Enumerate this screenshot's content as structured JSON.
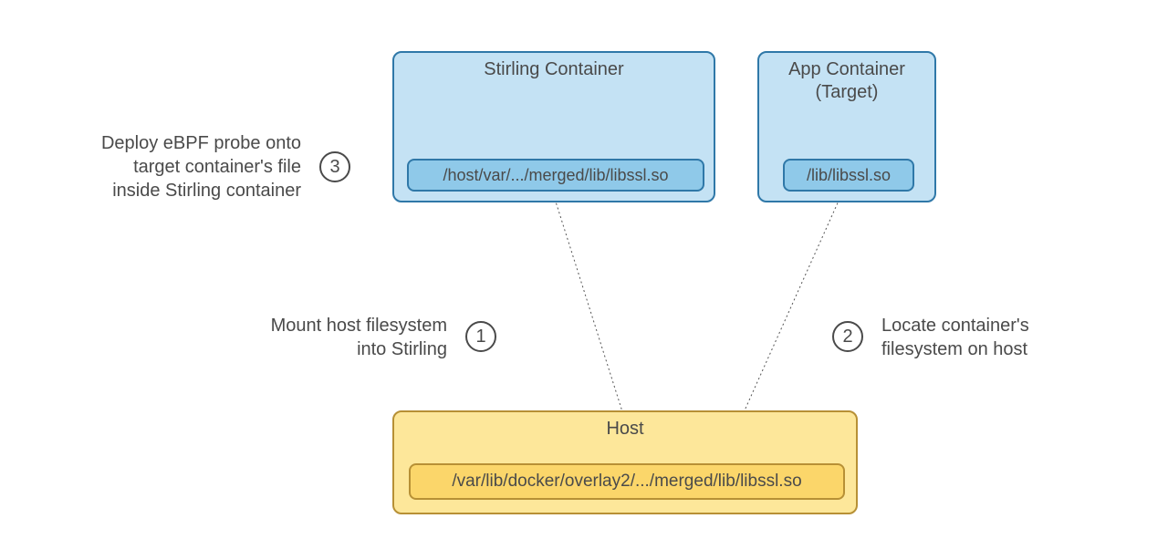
{
  "boxes": {
    "stirling": {
      "title": "Stirling Container",
      "path": "/host/var/.../merged/lib/libssl.so"
    },
    "app": {
      "title_line1": "App Container",
      "title_line2": "(Target)",
      "path": "/lib/libssl.so"
    },
    "host": {
      "title": "Host",
      "path": "/var/lib/docker/overlay2/.../merged/lib/libssl.so"
    }
  },
  "steps": {
    "one": {
      "num": "1",
      "label_line1": "Mount host filesystem",
      "label_line2": "into Stirling"
    },
    "two": {
      "num": "2",
      "label_line1": "Locate container's",
      "label_line2": "filesystem on host"
    },
    "three": {
      "num": "3",
      "label_line1": "Deploy eBPF probe onto",
      "label_line2": "target container's file",
      "label_line3": "inside Stirling container"
    }
  },
  "colors": {
    "blue_fill": "#c4e2f4",
    "blue_border": "#2f78a8",
    "yellow_fill": "#fde79a",
    "yellow_border": "#b79035"
  }
}
